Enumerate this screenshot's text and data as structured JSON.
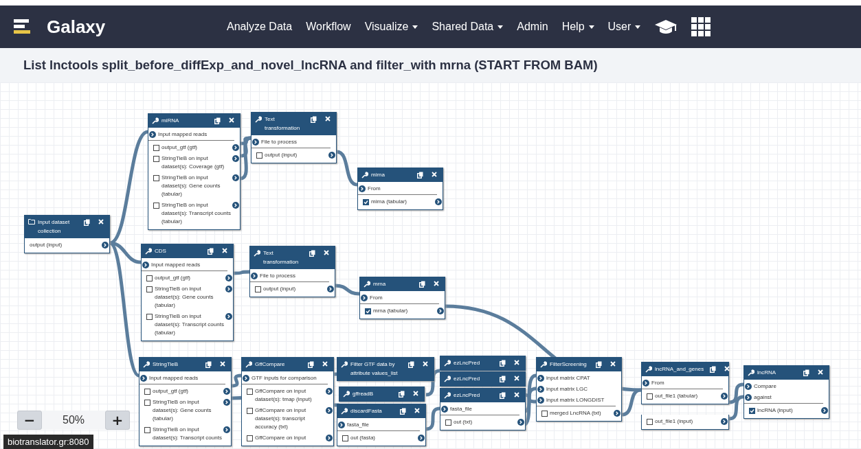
{
  "brand": "Galaxy",
  "nav": [
    {
      "label": "Analyze Data",
      "dropdown": false
    },
    {
      "label": "Workflow",
      "dropdown": false
    },
    {
      "label": "Visualize",
      "dropdown": true
    },
    {
      "label": "Shared Data",
      "dropdown": true
    },
    {
      "label": "Admin",
      "dropdown": false
    },
    {
      "label": "Help",
      "dropdown": true
    },
    {
      "label": "User",
      "dropdown": true
    }
  ],
  "title": "List lnctools split_before_diffExp_and_novel_lncRNA and filter_with mrna (START FROM BAM)",
  "canvas": {
    "nodes": [
      {
        "kind": "input",
        "title": "Input dataset collection",
        "outputs": [
          {
            "label": "output (input)",
            "checkbox": false
          }
        ]
      },
      {
        "kind": "tool",
        "title": "miRNA",
        "inputs": [
          "Input mapped reads"
        ],
        "outputs": [
          {
            "label": "output_gtf (gtf)",
            "checkbox": true,
            "checked": false
          },
          {
            "label": "StringTieB on input dataset(s): Coverage (gtf)",
            "checkbox": true,
            "checked": false
          },
          {
            "label": "StringTieB on input dataset(s): Gene counts (tabular)",
            "checkbox": true,
            "checked": false
          },
          {
            "label": "StringTieB on input dataset(s): Transcript counts (tabular)",
            "checkbox": true,
            "checked": false
          }
        ]
      },
      {
        "kind": "tool",
        "title": "Text transformation",
        "inputs": [
          "File to process"
        ],
        "outputs": [
          {
            "label": "output (input)",
            "checkbox": true,
            "checked": false
          }
        ]
      },
      {
        "kind": "tool",
        "title": "mirna",
        "inputs": [
          "From"
        ],
        "outputs": [
          {
            "label": "mirna (tabular)",
            "checkbox": true,
            "checked": true
          }
        ]
      },
      {
        "kind": "tool",
        "title": "CDS",
        "inputs": [
          "Input mapped reads"
        ],
        "outputs": [
          {
            "label": "output_gtf (gtf)",
            "checkbox": true,
            "checked": false
          },
          {
            "label": "StringTieB on input dataset(s): Gene counts (tabular)",
            "checkbox": true,
            "checked": false
          },
          {
            "label": "StringTieB on input dataset(s): Transcript counts (tabular)",
            "checkbox": true,
            "checked": false
          }
        ]
      },
      {
        "kind": "tool",
        "title": "Text transformation",
        "inputs": [
          "File to process"
        ],
        "outputs": [
          {
            "label": "output (input)",
            "checkbox": true,
            "checked": false
          }
        ]
      },
      {
        "kind": "tool",
        "title": "mrna",
        "inputs": [
          "From"
        ],
        "outputs": [
          {
            "label": "mrna (tabular)",
            "checkbox": true,
            "checked": true
          }
        ]
      },
      {
        "kind": "tool",
        "title": "StringTieB",
        "inputs": [
          "Input mapped reads"
        ],
        "outputs": [
          {
            "label": "output_gtf (gtf)",
            "checkbox": true,
            "checked": false
          },
          {
            "label": "StringTieB on input dataset(s): Gene counts (tabular)",
            "checkbox": true,
            "checked": false
          },
          {
            "label": "StringTieB on input dataset(s): Transcript counts",
            "checkbox": true,
            "checked": false
          }
        ]
      },
      {
        "kind": "tool",
        "title": "GffCompare",
        "inputs": [
          "GTF inputs for comparison"
        ],
        "outputs": [
          {
            "label": "GffCompare on input dataset(s): tmap (input)",
            "checkbox": true,
            "checked": false
          },
          {
            "label": "GffCompare on input dataset(s): transcript accuracy (txt)",
            "checkbox": true,
            "checked": false
          },
          {
            "label": "GffCompare on input",
            "checkbox": true,
            "checked": false
          }
        ]
      },
      {
        "kind": "tool",
        "title": "Filter GTF data by attribute values_list"
      },
      {
        "kind": "tool",
        "title": "gffreadB"
      },
      {
        "kind": "tool",
        "title": "discardFasta",
        "inputs": [
          "fasta_file"
        ],
        "outputs": [
          {
            "label": "out (fasta)",
            "checkbox": true,
            "checked": false
          }
        ]
      },
      {
        "kind": "tool",
        "title": "ezLncPred"
      },
      {
        "kind": "tool",
        "title": "ezLncPred"
      },
      {
        "kind": "tool",
        "title": "ezLncPred",
        "inputs": [
          "fasta_file"
        ],
        "outputs": [
          {
            "label": "out (txt)",
            "checkbox": true,
            "checked": false
          }
        ]
      },
      {
        "kind": "tool",
        "title": "FilterScreening",
        "inputs": [
          "input matrix CPAT",
          "input matrix LGC",
          "input matrix LONGDIST"
        ],
        "outputs": [
          {
            "label": "merged LncRNA (txt)",
            "checkbox": true,
            "checked": false
          }
        ]
      },
      {
        "kind": "tool",
        "title": "lncRNA_and_genes",
        "inputs": [
          "From"
        ],
        "outputs": [
          {
            "label": "out_file1 (tabular)",
            "checkbox": true,
            "checked": false
          }
        ]
      },
      {
        "kind": "tool",
        "outputs": [
          {
            "label": "out_file1 (input)",
            "checkbox": true,
            "checked": false
          }
        ]
      },
      {
        "kind": "tool",
        "title": "lncRNA",
        "inputs": [
          "Compare",
          "against"
        ],
        "outputs": [
          {
            "label": "lncRNA (input)",
            "checkbox": true,
            "checked": true
          }
        ]
      }
    ]
  },
  "zoom": {
    "minus": "−",
    "level_text": "50%",
    "plus": "+"
  },
  "status_url": "biotranslator.gr:8080"
}
